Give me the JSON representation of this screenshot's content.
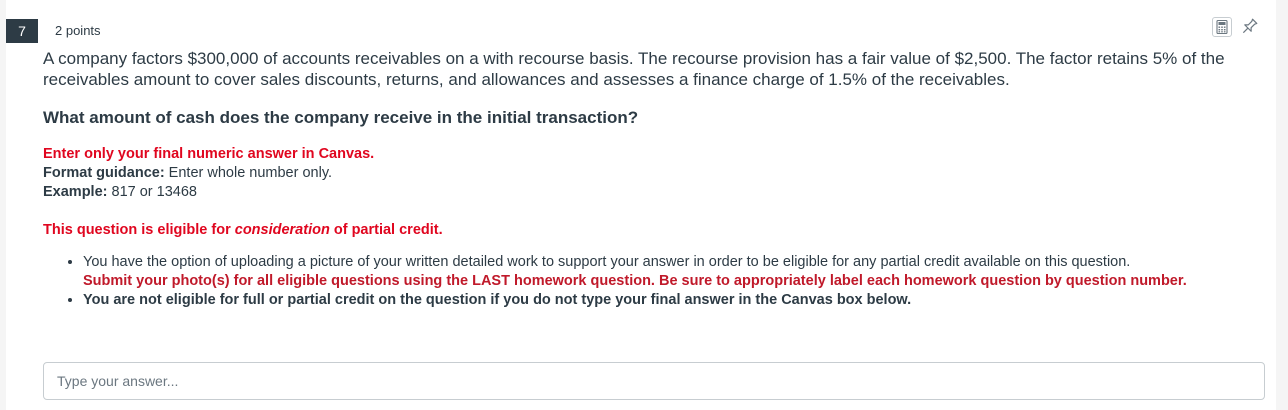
{
  "question": {
    "number": "7",
    "points": "2 points",
    "stem": "A company factors $300,000 of accounts receivables on a with recourse basis. The recourse provision has a fair value of $2,500. The factor retains 5% of the receivables amount to cover sales discounts, returns, and allowances and assesses a finance charge of 1.5% of the receivables.",
    "prompt": "What amount of cash does the company receive in the initial transaction?"
  },
  "instructions": {
    "enter_only": "Enter only your final numeric answer in Canvas.",
    "format_label": "Format guidance:",
    "format_text": " Enter whole number only.",
    "example_label": "Example:",
    "example_text": " 817 or 13468"
  },
  "partial_credit": {
    "pre": "This question is eligible for ",
    "emphasis": "consideration",
    "post": " of partial credit."
  },
  "bullets": {
    "first_text": "You have the option of uploading a picture of your written detailed work to support your answer in order to be eligible for any partial credit available on this question.",
    "first_highlight": "Submit your photo(s) for all eligible questions using the LAST homework question. Be sure to appropriately label each homework question by question number.",
    "second": "You are not eligible for full or partial credit on the question if you do not type your final answer in the Canvas box below."
  },
  "answer": {
    "placeholder": "Type your answer...",
    "value": ""
  },
  "icons": {
    "calculator": "calculator-icon",
    "pin": "pin-icon"
  },
  "colors": {
    "number_badge": "#2d3b45",
    "alert_red": "#e0061f",
    "highlight_red": "#c0192a",
    "text": "#2d3b45"
  }
}
